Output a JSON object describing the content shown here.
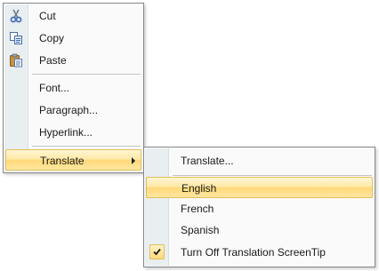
{
  "context_menu": {
    "items": [
      {
        "label": "Cut",
        "icon": "scissors-icon"
      },
      {
        "label": "Copy",
        "icon": "copy-icon"
      },
      {
        "label": "Paste",
        "icon": "paste-icon"
      },
      {
        "label": "Font..."
      },
      {
        "label": "Paragraph..."
      },
      {
        "label": "Hyperlink..."
      },
      {
        "label": "Translate",
        "has_submenu": true,
        "highlighted": true
      }
    ]
  },
  "translate_submenu": {
    "items": [
      {
        "label": "Translate..."
      },
      {
        "label": "English",
        "highlighted": true
      },
      {
        "label": "French"
      },
      {
        "label": "Spanish"
      },
      {
        "label": "Turn Off Translation ScreenTip",
        "checked": true
      }
    ]
  },
  "colors": {
    "highlight": "#ffe6a0",
    "highlight_border": "#e3bd5b",
    "icon_gutter": "#e9eef1",
    "menu_background": "#fafafa"
  }
}
